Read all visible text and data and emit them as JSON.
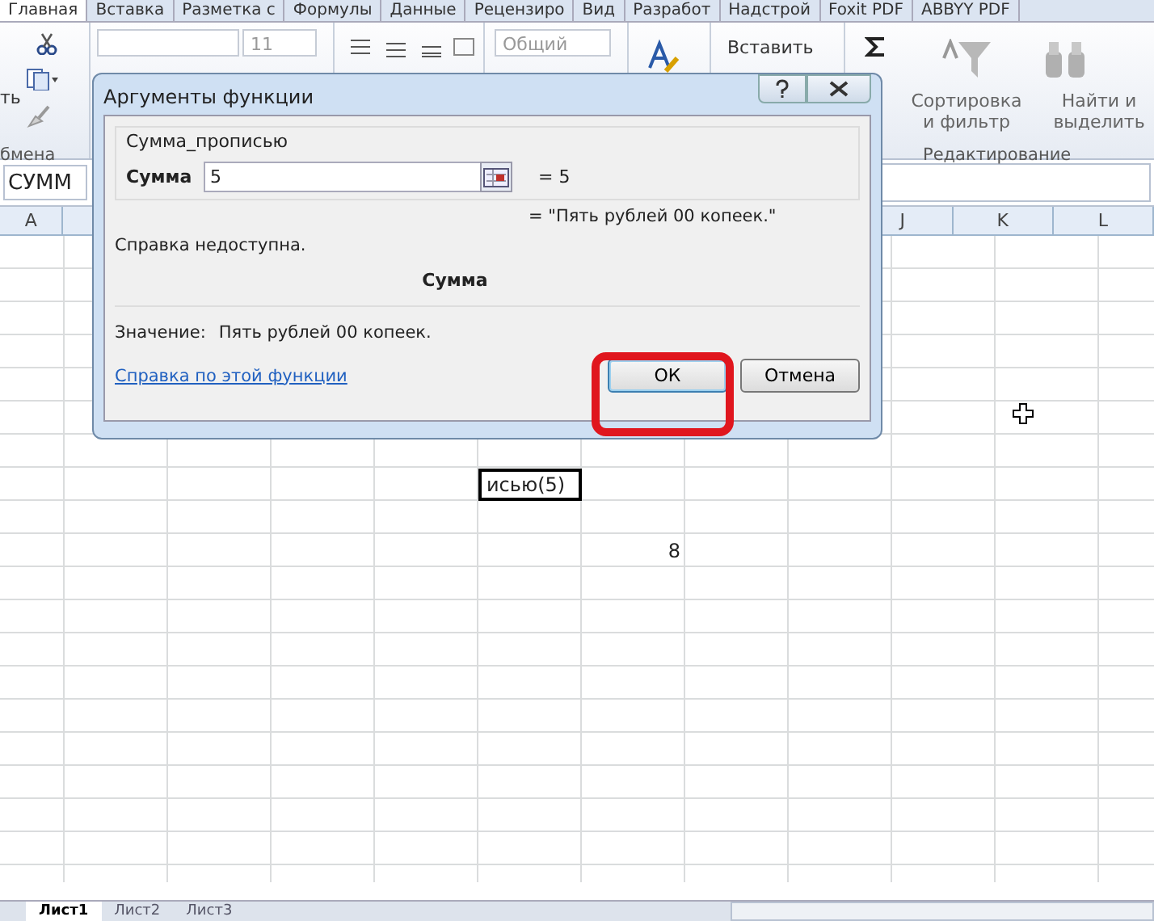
{
  "ribbon_tabs": [
    {
      "label": "Главная",
      "selected": true
    },
    {
      "label": "Вставка",
      "selected": false
    },
    {
      "label": "Разметка с",
      "selected": false
    },
    {
      "label": "Формулы",
      "selected": false
    },
    {
      "label": "Данные",
      "selected": false
    },
    {
      "label": "Рецензиро",
      "selected": false
    },
    {
      "label": "Вид",
      "selected": false
    },
    {
      "label": "Разработ",
      "selected": false
    },
    {
      "label": "Надстрой",
      "selected": false
    },
    {
      "label": "Foxit PDF",
      "selected": false
    },
    {
      "label": "ABBYY PDF",
      "selected": false
    }
  ],
  "ribbon": {
    "paste_label": "ть",
    "clipboard_group": "бмена",
    "font_size": "11",
    "number_format": "Общий",
    "insert_label": "Вставить",
    "sort_label": "Сортировка и фильтр",
    "find_label": "Найти и выделить",
    "editing_group": "Редактирование"
  },
  "name_box": "СУММ",
  "column_headers": {
    "left": [
      "A"
    ],
    "right": [
      "J",
      "K",
      "L"
    ]
  },
  "cells": [
    {
      "text": "исью(5)",
      "selected": true
    },
    {
      "text": "8",
      "selected": false
    }
  ],
  "dialog": {
    "title": "Аргументы функции",
    "function_name": "Сумма_прописью",
    "argument": {
      "label": "Сумма",
      "value": "5",
      "result": "= 5"
    },
    "result": "= \"Пять рублей  00 копеек.\"",
    "help_text": "Справка недоступна.",
    "argument_heading": "Сумма",
    "value_label": "Значение:",
    "value_text": "Пять рублей  00 копеек.",
    "help_link": "Справка по этой функции",
    "buttons": [
      {
        "label": "ОК",
        "default": true
      },
      {
        "label": "Отмена",
        "default": false
      }
    ]
  },
  "sheet_tabs": [
    {
      "label": "Лист1",
      "selected": true
    },
    {
      "label": "Лист2",
      "selected": false
    },
    {
      "label": "Лист3",
      "selected": false
    }
  ]
}
